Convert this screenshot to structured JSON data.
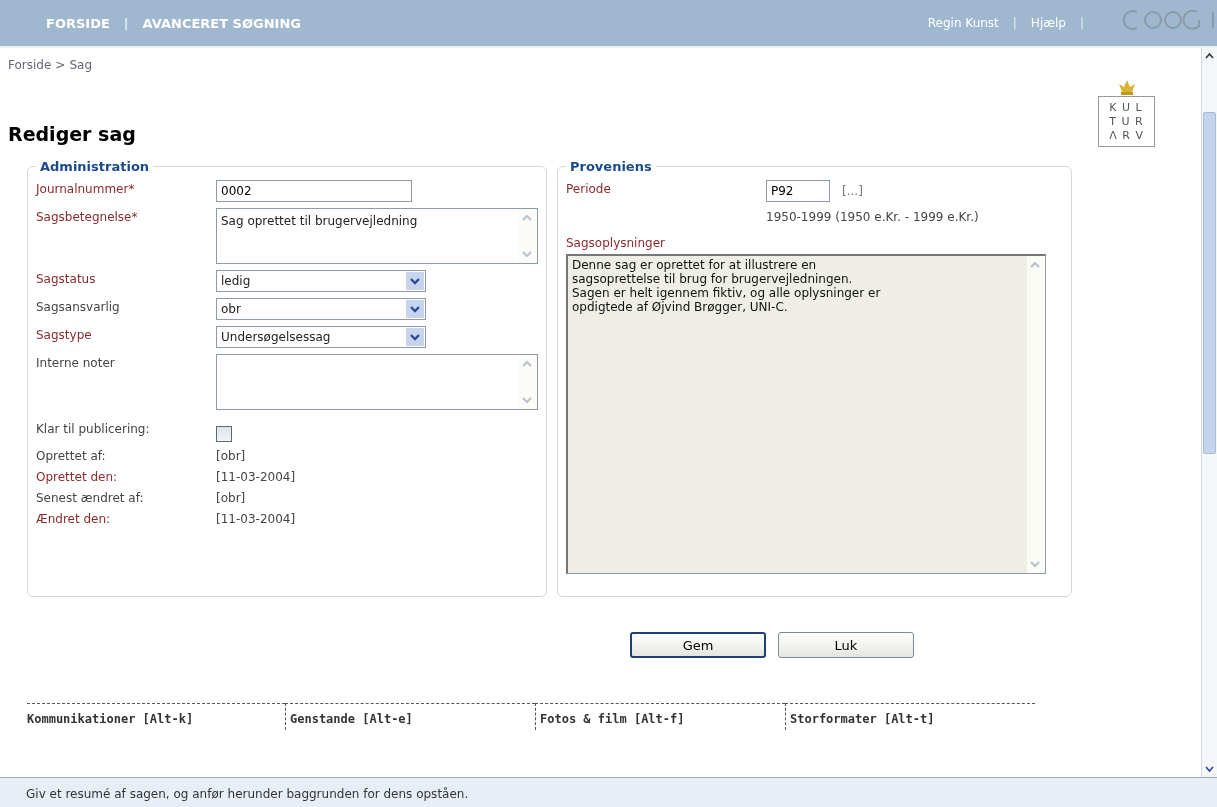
{
  "top_nav": {
    "left": [
      {
        "kind": "link",
        "label": "FORSIDE"
      },
      {
        "kind": "separator",
        "label": "|"
      },
      {
        "kind": "link",
        "label": "AVANCERET SØGNING"
      }
    ],
    "right": [
      {
        "kind": "link",
        "label": "Regin Kunst"
      },
      {
        "kind": "separator",
        "label": "|"
      },
      {
        "kind": "link",
        "label": "Hjælp"
      },
      {
        "kind": "separator",
        "label": "|"
      }
    ]
  },
  "breadcrumb": [
    {
      "kind": "link",
      "label": "Forside"
    },
    {
      "kind": "separator",
      "label": ">"
    },
    {
      "kind": "link",
      "label": "Sag"
    }
  ],
  "page_title": "Rediger sag",
  "org_logo": {
    "lines": [
      "K U L",
      "T U R",
      "Λ R V"
    ]
  },
  "administration": {
    "legend": "Administration",
    "fields": [
      {
        "kind": "text",
        "label": "Journalnummer*",
        "required": true,
        "value": "0002"
      },
      {
        "kind": "textarea",
        "label": "Sagsbetegnelse*",
        "required": true,
        "value": "Sag oprettet til brugervejledning"
      },
      {
        "kind": "select",
        "label": "Sagstatus",
        "required": true,
        "value": "ledig"
      },
      {
        "kind": "select",
        "label": "Sagsansvarlig",
        "required": false,
        "value": "obr"
      },
      {
        "kind": "select",
        "label": "Sagstype",
        "required": true,
        "value": "Undersøgelsessag"
      },
      {
        "kind": "textarea",
        "label": "Interne noter",
        "required": false
      },
      {
        "kind": "checkbox",
        "label": "Klar til publicering:",
        "required": false,
        "checked": false
      },
      {
        "kind": "readonly",
        "label": "Oprettet af:",
        "required": false,
        "value": "[obr]"
      },
      {
        "kind": "readonly",
        "label": "Oprettet den:",
        "required": true,
        "value": "[11-03-2004]"
      },
      {
        "kind": "readonly",
        "label": "Senest ændret af:",
        "required": false,
        "value": "[obr]"
      },
      {
        "kind": "readonly",
        "label": "Ændret den:",
        "required": true,
        "value": "[11-03-2004]"
      }
    ]
  },
  "proveniens": {
    "legend": "Proveniens",
    "periode": {
      "label": "Periode",
      "value": "P92",
      "lookup": "[...]",
      "description": "1950-1999 (1950 e.Kr. - 1999 e.Kr.)"
    },
    "sagsoplysninger": {
      "label": "Sagsoplysninger",
      "value": "Denne sag er oprettet for at illustrere en\nsagsoprettelse til brug for brugervejledningen.\nSagen er helt igennem fiktiv, og alle oplysninger er\nopdigtede af Øjvind Brøgger, UNI-C."
    }
  },
  "buttons": [
    {
      "label": "Gem",
      "focused": true
    },
    {
      "label": "Luk",
      "focused": false
    }
  ],
  "tabs": [
    {
      "label": "Kommunikationer [Alt-k]"
    },
    {
      "label": "Genstande [Alt-e]"
    },
    {
      "label": "Fotos & film [Alt-f]"
    },
    {
      "label": "Storformater [Alt-t]"
    }
  ],
  "status_bar": "Giv et resumé af sagen, og anfør herunder baggrunden for dens opståen."
}
